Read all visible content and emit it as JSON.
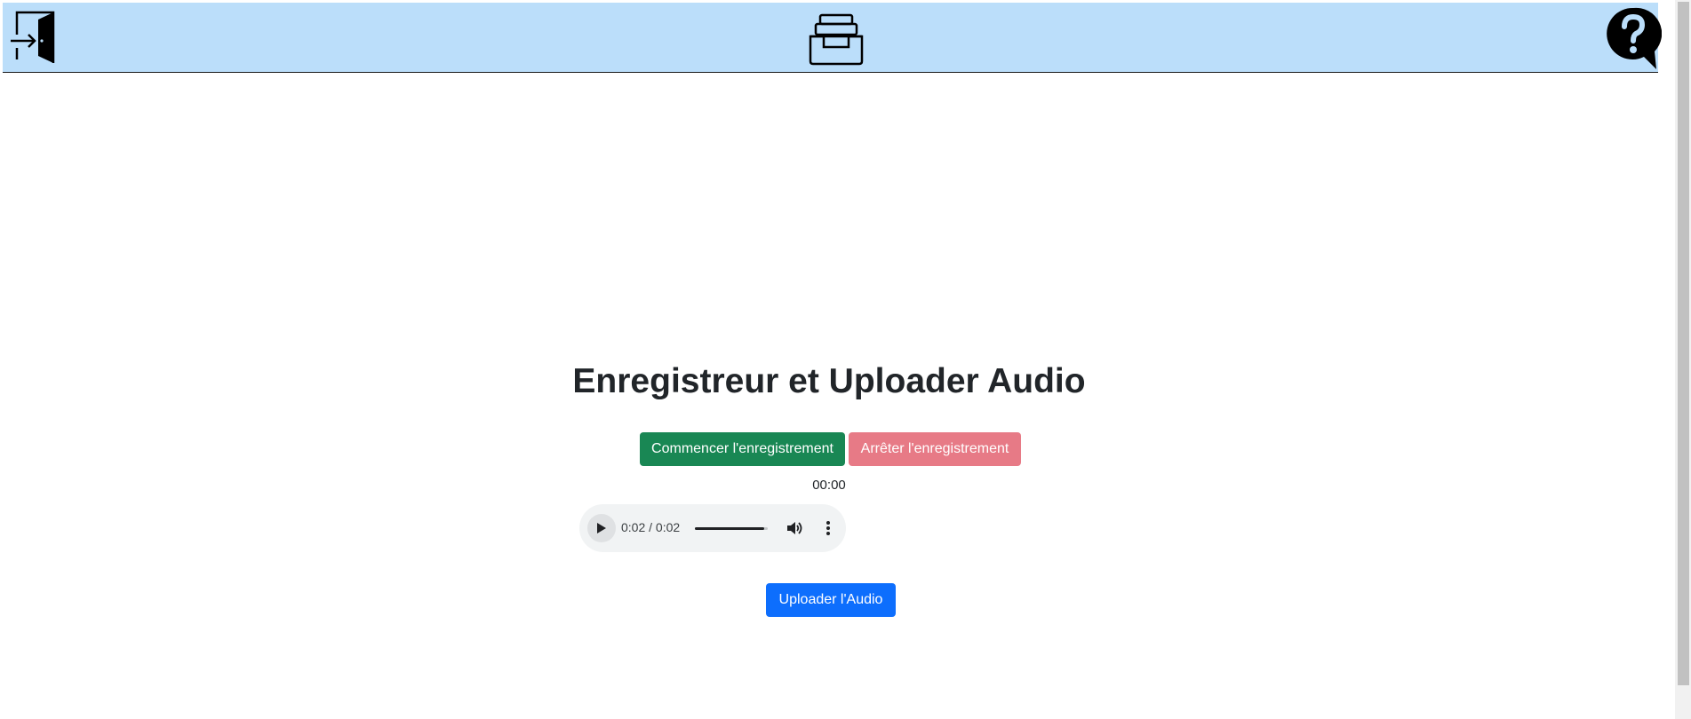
{
  "header": {
    "exit_icon": "exit-door-icon",
    "archive_icon": "archive-inbox-icon",
    "help_icon": "help-bubble-icon",
    "background": "#bbdefa"
  },
  "main": {
    "title": "Enregistreur et Uploader Audio",
    "start_label": "Commencer l'enregistrement",
    "stop_label": "Arrêter l'enregistrement",
    "timer": "00:00",
    "upload_label": "Uploader l'Audio"
  },
  "audio_player": {
    "current_time": "0:02",
    "separator": " / ",
    "duration": "0:02",
    "progress": 0.95,
    "icons": [
      "play-icon",
      "volume-icon",
      "more-options-icon"
    ]
  },
  "colors": {
    "start": "#198754",
    "stop": "#e77a86",
    "upload": "#0d6efd"
  }
}
